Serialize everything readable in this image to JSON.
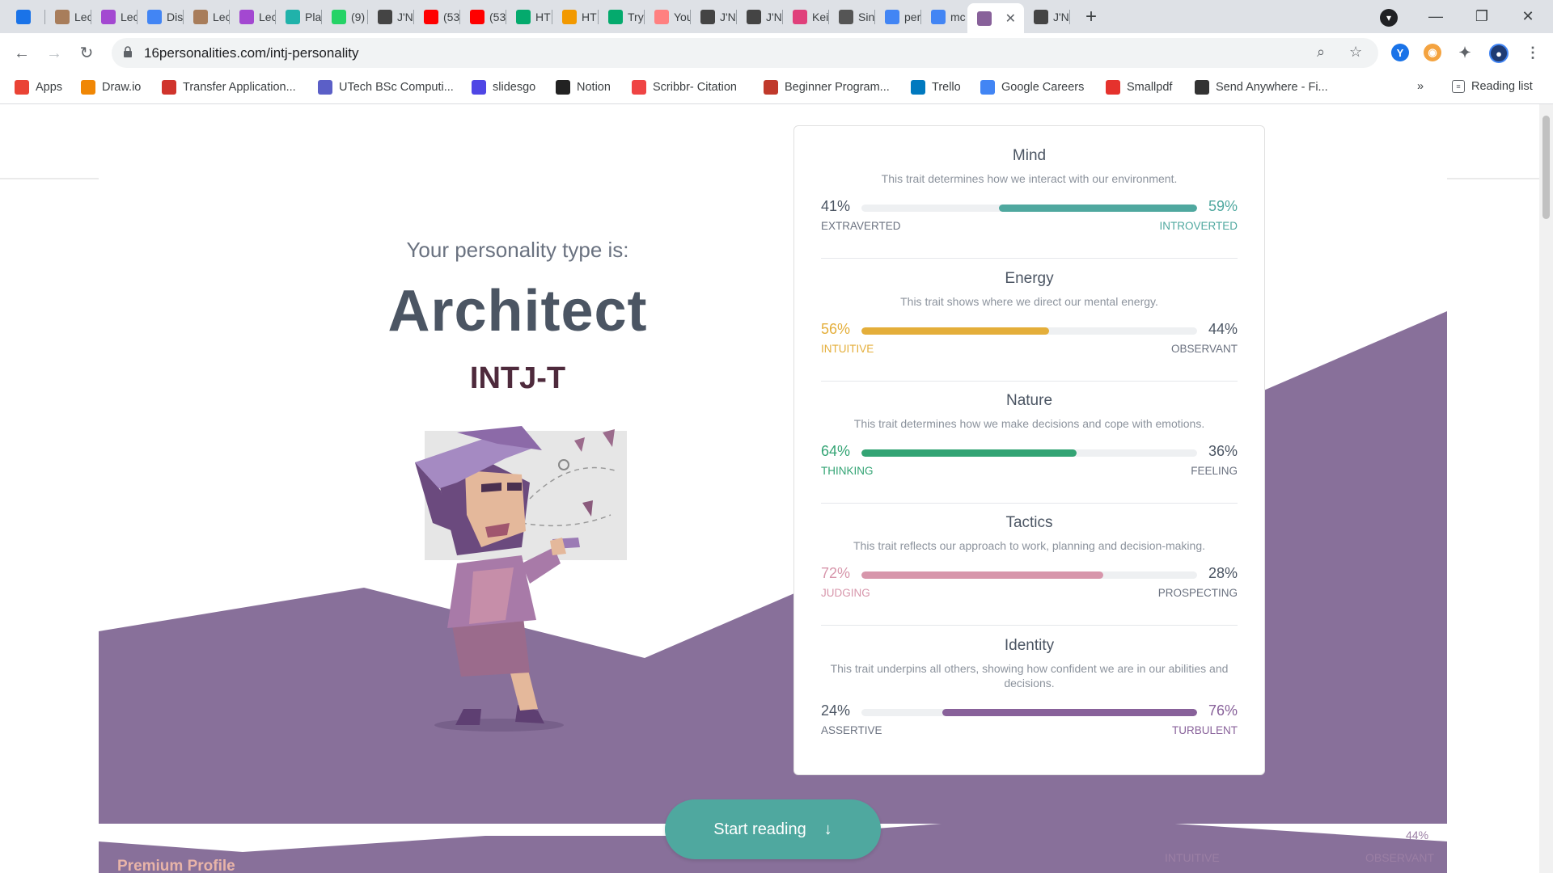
{
  "browser": {
    "tabs": [
      {
        "title": "",
        "icon": "vivaldi-y-icon",
        "color": "#1a73e8"
      },
      {
        "title": "Lec",
        "icon": "lamp-icon",
        "color": "#a87d5b"
      },
      {
        "title": "Lec",
        "icon": "play-icon",
        "color": "#a348d1"
      },
      {
        "title": "Dis",
        "icon": "docs-icon",
        "color": "#4285f4"
      },
      {
        "title": "Lec",
        "icon": "lamp-icon",
        "color": "#a87d5b"
      },
      {
        "title": "Lec",
        "icon": "play-icon",
        "color": "#a348d1"
      },
      {
        "title": "Pla",
        "icon": "c-icon",
        "color": "#20b2aa"
      },
      {
        "title": "(9)",
        "icon": "whatsapp-icon",
        "color": "#25d366"
      },
      {
        "title": "J'N",
        "icon": "butterfly-icon",
        "color": "#444444"
      },
      {
        "title": "(53",
        "icon": "youtube-icon",
        "color": "#ff0000"
      },
      {
        "title": "(53",
        "icon": "youtube-icon",
        "color": "#ff0000"
      },
      {
        "title": "HT",
        "icon": "w3-icon",
        "color": "#04aa6d"
      },
      {
        "title": "HT",
        "icon": "q-icon",
        "color": "#f29900"
      },
      {
        "title": "Try",
        "icon": "w3-icon",
        "color": "#04aa6d"
      },
      {
        "title": "You",
        "icon": "youtube-outline-icon",
        "color": "#ff8080"
      },
      {
        "title": "J'N",
        "icon": "butterfly-icon",
        "color": "#444444"
      },
      {
        "title": "J'N",
        "icon": "butterfly-icon",
        "color": "#444444"
      },
      {
        "title": "Kei",
        "icon": "globe-icon",
        "color": "#e0407b"
      },
      {
        "title": "Sin",
        "icon": "bars-icon",
        "color": "#555555"
      },
      {
        "title": "per",
        "icon": "google-icon",
        "color": "#4285f4"
      },
      {
        "title": "mc",
        "icon": "google-icon",
        "color": "#4285f4"
      },
      {
        "title": "",
        "icon": "sixteen-personalities-icon",
        "color": "#88619a",
        "active": true
      },
      {
        "title": "J'N",
        "icon": "butterfly-icon",
        "color": "#444444"
      }
    ],
    "url": "16personalities.com/intj-personality",
    "bookmarks": [
      {
        "label": "Apps",
        "icon": "apps-grid-icon",
        "color": "#ea4335"
      },
      {
        "label": "Draw.io",
        "icon": "drawio-icon",
        "color": "#f08705"
      },
      {
        "label": "Transfer Application...",
        "icon": "transfer-icon",
        "color": "#d0342c"
      },
      {
        "label": "UTech BSc Computi...",
        "icon": "people-icon",
        "color": "#5b5fc7"
      },
      {
        "label": "slidesgo",
        "icon": "slidesgo-icon",
        "color": "#4f46e5"
      },
      {
        "label": "Notion",
        "icon": "check-icon",
        "color": "#222222"
      },
      {
        "label": "Scribbr- Citation",
        "icon": "scribbr-icon",
        "color": "#ef4444"
      },
      {
        "label": "Beginner Program...",
        "icon": "video-icon",
        "color": "#c0392b"
      },
      {
        "label": "Trello",
        "icon": "trello-icon",
        "color": "#0079bf"
      },
      {
        "label": "Google Careers",
        "icon": "google-icon",
        "color": "#4285f4"
      },
      {
        "label": "Smallpdf",
        "icon": "smallpdf-icon",
        "color": "#e5322d"
      },
      {
        "label": "Send Anywhere - Fi...",
        "icon": "send-anywhere-icon",
        "color": "#333333"
      }
    ],
    "overflow_label": "»",
    "reading_list_label": "Reading list"
  },
  "header": {
    "intro": "Your personality type is:",
    "type_name": "Architect",
    "type_code": "INTJ-T"
  },
  "traits": [
    {
      "title": "Mind",
      "description": "This trait determines how we interact with our environment.",
      "left_pct": "41%",
      "right_pct": "59%",
      "left_label": "EXTRAVERTED",
      "right_label": "INTROVERTED",
      "dominant": "right",
      "value": 59,
      "color": "#4fa89f"
    },
    {
      "title": "Energy",
      "description": "This trait shows where we direct our mental energy.",
      "left_pct": "56%",
      "right_pct": "44%",
      "left_label": "INTUITIVE",
      "right_label": "OBSERVANT",
      "dominant": "left",
      "value": 56,
      "color": "#e4ae3a"
    },
    {
      "title": "Nature",
      "description": "This trait determines how we make decisions and cope with emotions.",
      "left_pct": "64%",
      "right_pct": "36%",
      "left_label": "THINKING",
      "right_label": "FEELING",
      "dominant": "left",
      "value": 64,
      "color": "#33a474"
    },
    {
      "title": "Tactics",
      "description": "This trait reflects our approach to work, planning and decision-making.",
      "left_pct": "72%",
      "right_pct": "28%",
      "left_label": "JUDGING",
      "right_label": "PROSPECTING",
      "dominant": "left",
      "value": 72,
      "color": "#d796ab"
    },
    {
      "title": "Identity",
      "description": "This trait underpins all others, showing how confident we are in our abilities and decisions.",
      "left_pct": "24%",
      "right_pct": "76%",
      "left_label": "ASSERTIVE",
      "right_label": "TURBULENT",
      "dominant": "right",
      "value": 76,
      "color": "#88619a"
    }
  ],
  "cta": {
    "label": "Start reading"
  },
  "footer": {
    "premium_label": "Premium Profile",
    "ghost_pct": "44%",
    "ghost_left_label": "INTUITIVE",
    "ghost_right_label": "OBSERVANT"
  },
  "colors": {
    "accent_purple": "#88709a",
    "text_neutral": "#4b5563",
    "type_code": "#4e2a3c",
    "right_label_neutral": "#6b7280"
  }
}
